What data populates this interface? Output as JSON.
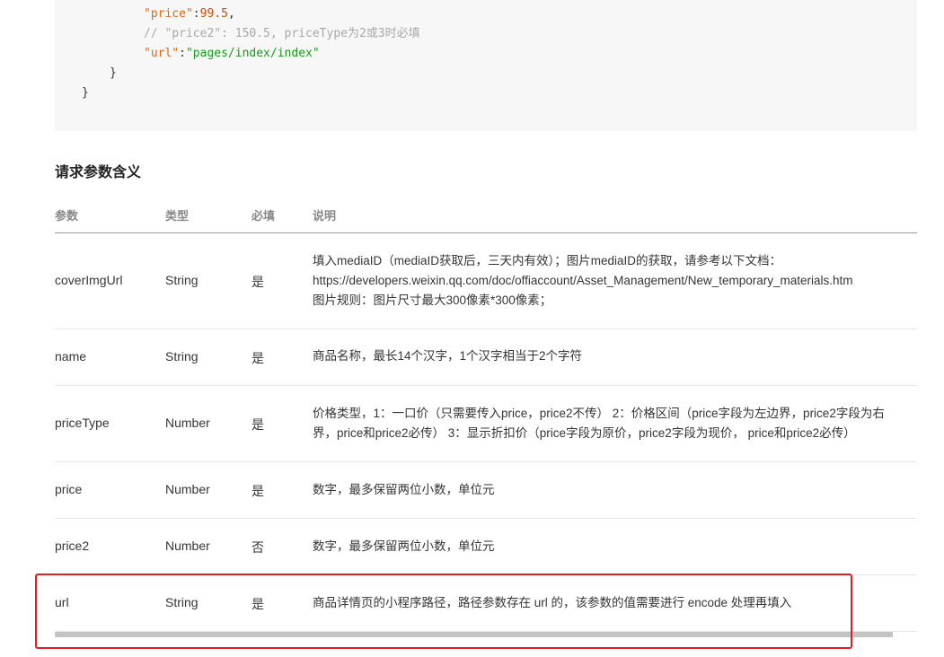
{
  "code": {
    "line_price_key": "\"price\"",
    "line_price_val": "99.5",
    "comment": "// \"price2\": 150.5, priceType为2或3时必填",
    "line_url_key": "\"url\"",
    "line_url_val": "\"pages/index/index\"",
    "brace_inner": "}",
    "brace_outer": "}"
  },
  "section_title": "请求参数含义",
  "table": {
    "headers": [
      "参数",
      "类型",
      "必填",
      "说明"
    ],
    "rows": [
      {
        "param": "coverImgUrl",
        "type": "String",
        "required": "是",
        "desc": [
          "填入mediaID（mediaID获取后，三天内有效）；图片mediaID的获取，请参考以下文档：",
          "https://developers.weixin.qq.com/doc/offiaccount/Asset_Management/New_temporary_materials.htm",
          "图片规则：图片尺寸最大300像素*300像素；"
        ]
      },
      {
        "param": "name",
        "type": "String",
        "required": "是",
        "desc": [
          "商品名称，最长14个汉字，1个汉字相当于2个字符"
        ]
      },
      {
        "param": "priceType",
        "type": "Number",
        "required": "是",
        "desc": [
          "价格类型，1：一口价（只需要传入price，price2不传） 2：价格区间（price字段为左边界，price2字段为右",
          "界，price和price2必传） 3：显示折扣价（price字段为原价，price2字段为现价， price和price2必传）"
        ]
      },
      {
        "param": "price",
        "type": "Number",
        "required": "是",
        "desc": [
          "数字，最多保留两位小数，单位元"
        ]
      },
      {
        "param": "price2",
        "type": "Number",
        "required": "否",
        "desc": [
          "数字，最多保留两位小数，单位元"
        ]
      },
      {
        "param": "url",
        "type": "String",
        "required": "是",
        "desc": [
          "商品详情页的小程序路径，路径参数存在 url 的，该参数的值需要进行 encode 处理再填入"
        ]
      }
    ]
  },
  "colors": {
    "highlight": "#e02020",
    "code_bg": "#f7f7f7"
  }
}
